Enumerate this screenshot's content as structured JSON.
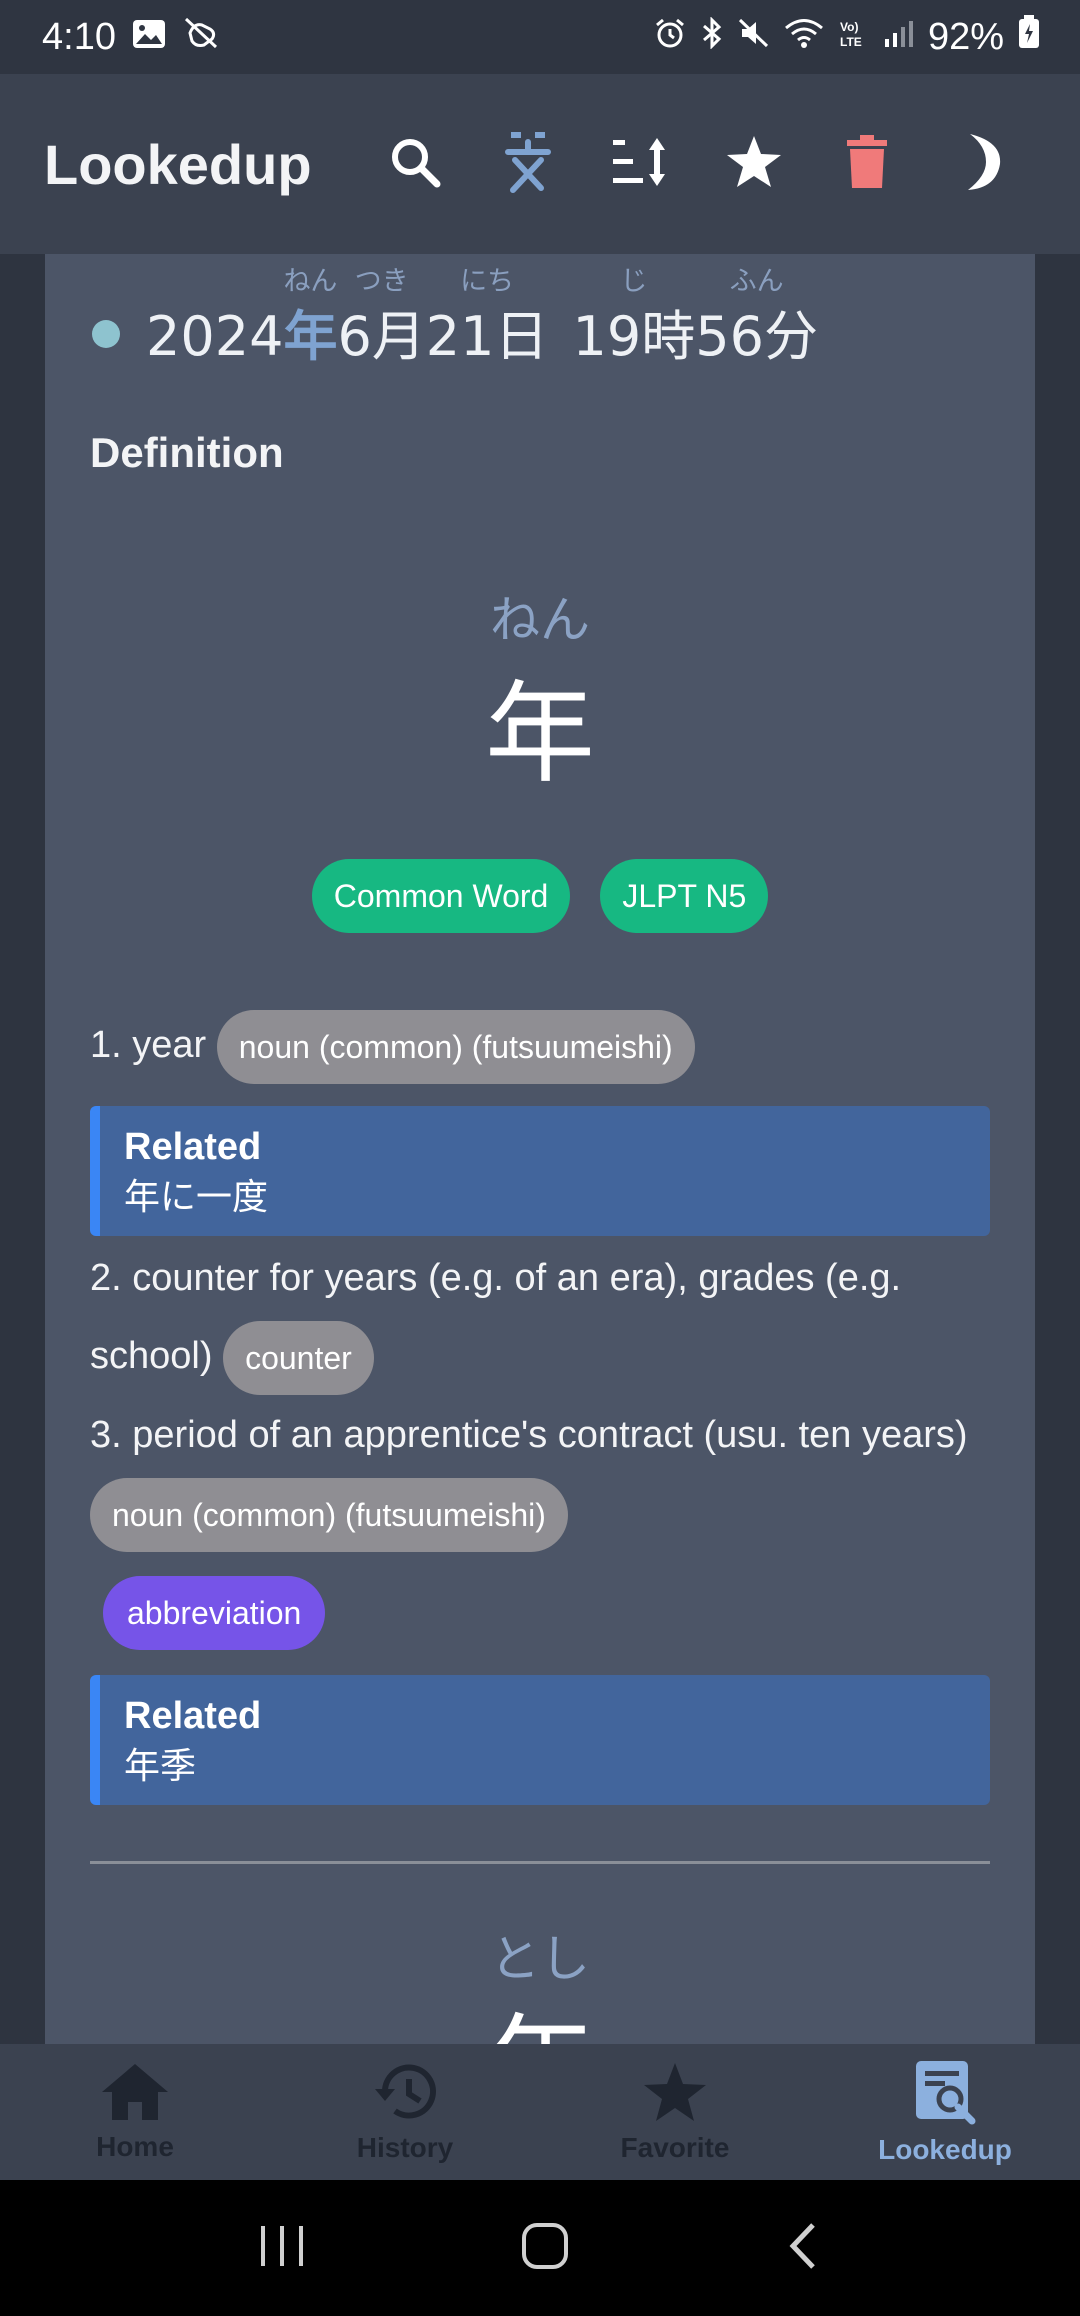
{
  "status_bar": {
    "time": "4:10",
    "battery": "92%"
  },
  "app_bar": {
    "title": "Lookedup"
  },
  "sentence": {
    "tokens": [
      {
        "text": "2024",
        "furigana": ""
      },
      {
        "text": "年",
        "furigana": "ねん"
      },
      {
        "text": "6月",
        "furigana": "つき"
      },
      {
        "text": "21日",
        "furigana": "にち"
      },
      {
        "text": "19時",
        "furigana": "じ"
      },
      {
        "text": "56分",
        "furigana": "ふん"
      }
    ]
  },
  "definition_heading": "Definition",
  "entry": {
    "reading": "ねん",
    "headword": "年",
    "tags": [
      "Common Word",
      "JLPT N5"
    ],
    "senses": [
      {
        "number": "1.",
        "gloss": "year",
        "pos": "noun (common) (futsuumeishi)"
      },
      {
        "number": "2.",
        "gloss": "counter for years (e.g. of an era), grades (e.g. school)",
        "pos": "counter"
      },
      {
        "number": "3.",
        "gloss": "period of an apprentice's contract (usu. ten years)",
        "pos": "noun (common) (futsuumeishi)",
        "misc": "abbreviation"
      }
    ],
    "related": [
      {
        "label": "Related",
        "text": "年に一度"
      },
      {
        "label": "Related",
        "text": "年季"
      }
    ]
  },
  "next_entry": {
    "reading": "とし",
    "headword": "年"
  },
  "bottom_nav": {
    "items": [
      {
        "label": "Home",
        "icon": "home-icon"
      },
      {
        "label": "History",
        "icon": "history-icon"
      },
      {
        "label": "Favorite",
        "icon": "star-icon"
      },
      {
        "label": "Lookedup",
        "icon": "lookup-icon"
      }
    ],
    "active": "Lookedup"
  },
  "colors": {
    "accent_blue": "#8cb0de",
    "tag_green": "#17b882",
    "pill_gray": "#8f8e93",
    "pill_purple": "#7654e8",
    "related_bg": "#42659c",
    "trash_red": "#f07a7a"
  }
}
